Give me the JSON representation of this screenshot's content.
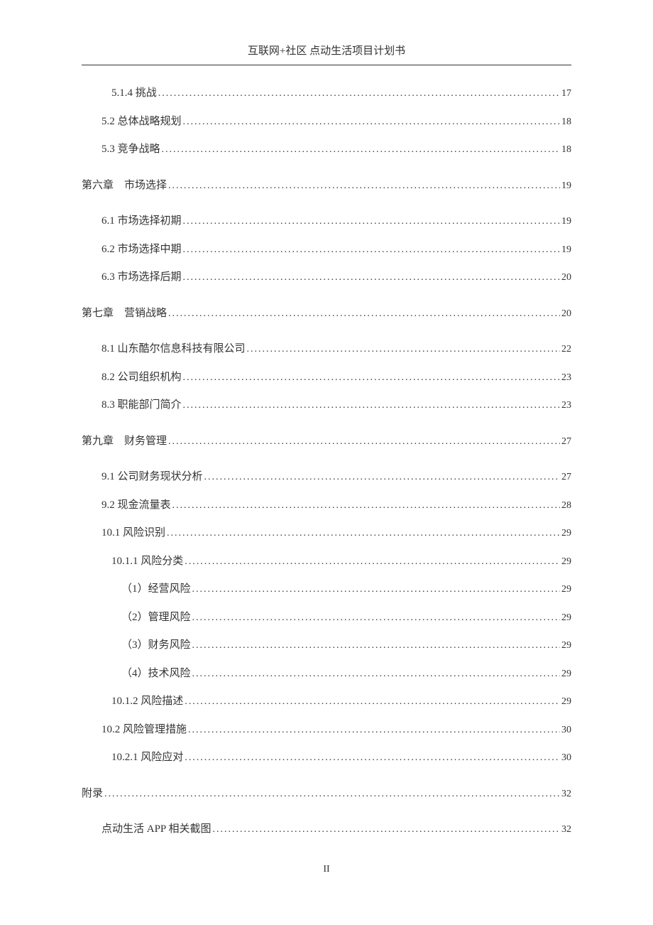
{
  "header": "互联网+社区 点动生活项目计划书",
  "pageNumber": "II",
  "entries": [
    {
      "label": "5.1.4 挑战",
      "page": "17",
      "level": "subsection"
    },
    {
      "label": "5.2 总体战略规划",
      "page": "18",
      "level": "section"
    },
    {
      "label": "5.3 竞争战略",
      "page": "18",
      "level": "section"
    },
    {
      "label": "第六章　市场选择",
      "page": "19",
      "level": "chapter"
    },
    {
      "label": "6.1 市场选择初期",
      "page": "19",
      "level": "section"
    },
    {
      "label": "6.2 市场选择中期",
      "page": "19",
      "level": "section"
    },
    {
      "label": "6.3 市场选择后期",
      "page": "20",
      "level": "section"
    },
    {
      "label": "第七章　营销战略",
      "page": "20",
      "level": "chapter"
    },
    {
      "label": "8.1  山东酷尔信息科技有限公司",
      "page": "22",
      "level": "section"
    },
    {
      "label": "8.2 公司组织机构",
      "page": "23",
      "level": "section"
    },
    {
      "label": "8.3 职能部门简介",
      "page": "23",
      "level": "section"
    },
    {
      "label": "第九章　财务管理",
      "page": "27",
      "level": "chapter"
    },
    {
      "label": "9.1  公司财务现状分析",
      "page": "27",
      "level": "section"
    },
    {
      "label": "9.2 现金流量表",
      "page": "28",
      "level": "section"
    },
    {
      "label": "10.1  风险识别",
      "page": "29",
      "level": "section"
    },
    {
      "label": "10.1.1  风险分类",
      "page": "29",
      "level": "subsection"
    },
    {
      "label": "（1）经营风险",
      "page": "29",
      "level": "subsub"
    },
    {
      "label": "（2）管理风险",
      "page": "29",
      "level": "subsub"
    },
    {
      "label": "（3）财务风险",
      "page": "29",
      "level": "subsub"
    },
    {
      "label": "（4）技术风险",
      "page": "29",
      "level": "subsub"
    },
    {
      "label": "10.1.2  风险描述",
      "page": "29",
      "level": "subsection"
    },
    {
      "label": "10.2  风险管理措施",
      "page": "30",
      "level": "section"
    },
    {
      "label": "10.2.1  风险应对",
      "page": "30",
      "level": "subsection"
    },
    {
      "label": "附录",
      "page": "32",
      "level": "chapter"
    },
    {
      "label": "点动生活 APP 相关截图",
      "page": "32",
      "level": "section"
    }
  ]
}
